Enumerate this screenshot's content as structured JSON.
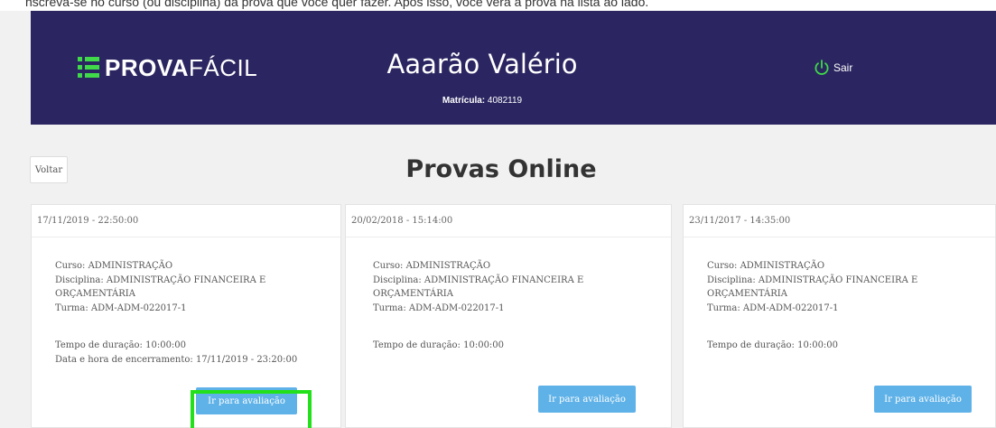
{
  "top_strip": "nscreva-se no curso (ou disciplina) da prova que você quer fazer. Após isso, você verá a prova na lista ao lado.",
  "header": {
    "logo": {
      "bold": "PROVA",
      "light": "FÁCIL"
    },
    "user_name": "Aaarão Valério",
    "matricula_label": "Matrícula:",
    "matricula_value": "4082119",
    "logout_label": "Sair",
    "logout_icon": "power-icon"
  },
  "toolbar": {
    "back_label": "Voltar"
  },
  "page_title": "Provas Online",
  "colors": {
    "header_bg": "#2b2661",
    "accent_green": "#3fd94a",
    "button_blue": "#5fb2e8",
    "highlight": "#22e01a"
  },
  "cards": [
    {
      "datetime": "17/11/2019 - 22:50:00",
      "curso": "Curso: ADMINISTRAÇÃO",
      "disciplina_1": "Disciplina: ADMINISTRAÇÃO FINANCEIRA E",
      "disciplina_2": "ORÇAMENTÁRIA",
      "turma": "Turma: ADM-ADM-022017-1",
      "duracao": "Tempo de duração: 10:00:00",
      "encerramento": "Data e hora de encerramento: 17/11/2019 - 23:20:00",
      "button": "Ir para avaliação"
    },
    {
      "datetime": "20/02/2018 - 15:14:00",
      "curso": "Curso: ADMINISTRAÇÃO",
      "disciplina_1": "Disciplina: ADMINISTRAÇÃO FINANCEIRA E",
      "disciplina_2": "ORÇAMENTÁRIA",
      "turma": "Turma: ADM-ADM-022017-1",
      "duracao": "Tempo de duração: 10:00:00",
      "button": "Ir para avaliação"
    },
    {
      "datetime": "23/11/2017 - 14:35:00",
      "curso": "Curso: ADMINISTRAÇÃO",
      "disciplina_1": "Disciplina: ADMINISTRAÇÃO FINANCEIRA E",
      "disciplina_2": "ORÇAMENTÁRIA",
      "turma": "Turma: ADM-ADM-022017-1",
      "duracao": "Tempo de duração: 10:00:00",
      "button": "Ir para avaliação"
    }
  ]
}
